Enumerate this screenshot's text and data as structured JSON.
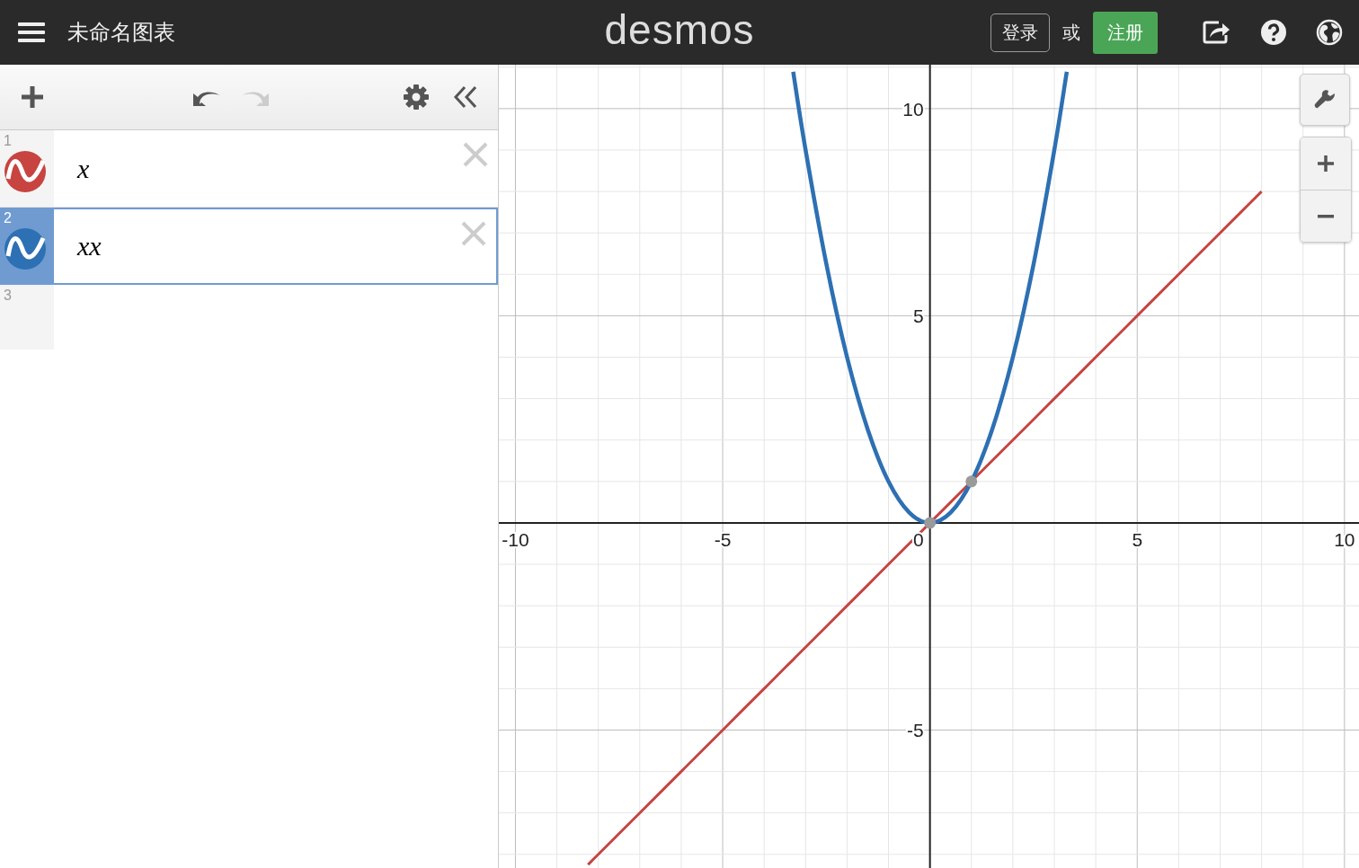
{
  "header": {
    "title": "未命名图表",
    "logo": "desmos",
    "login": "登录",
    "or": "或",
    "signup": "注册"
  },
  "expressions": [
    {
      "number": "1",
      "latex": "x",
      "color": "#c74440",
      "selected": false
    },
    {
      "number": "2",
      "latex": "xx",
      "color": "#2d70b3",
      "selected": true
    },
    {
      "number": "3"
    }
  ],
  "graph": {
    "chart_data": {
      "type": "line",
      "x": [
        -8.25,
        -8,
        -7.5,
        -7,
        -6.5,
        -6,
        -5.5,
        -5,
        -4.5,
        -4,
        -3.5,
        -3.3,
        -3,
        -2.5,
        -2,
        -1.5,
        -1,
        -0.5,
        0,
        0.5,
        1,
        1.5,
        2,
        2.5,
        3,
        3.3,
        3.5,
        4,
        4.5,
        5,
        5.5,
        6,
        6.5,
        7,
        7.5,
        8
      ],
      "series": [
        {
          "color": "#c74440",
          "values": [
            -8.25,
            -8,
            -7.5,
            -7,
            -6.5,
            -6,
            -5.5,
            -5,
            -4.5,
            -4,
            -3.5,
            -3.3,
            -3,
            -2.5,
            -2,
            -1.5,
            -1,
            -0.5,
            0,
            0.5,
            1,
            1.5,
            2,
            2.5,
            3,
            3.3,
            3.5,
            4,
            4.5,
            5,
            5.5,
            6,
            6.5,
            7,
            7.5,
            8
          ]
        },
        {
          "color": "#2d70b3",
          "values": [
            null,
            null,
            null,
            null,
            null,
            null,
            null,
            null,
            null,
            null,
            null,
            10.89,
            9,
            6.25,
            4,
            2.25,
            1,
            0.25,
            0,
            0.25,
            1,
            2.25,
            4,
            6.25,
            9,
            10.89,
            null,
            null,
            null,
            null,
            null,
            null,
            null,
            null,
            null,
            null
          ]
        }
      ],
      "xlim": [
        -10.4,
        10.35
      ],
      "ylim": [
        -8.33,
        11.06
      ],
      "xticks": [
        -10,
        -5,
        0,
        5,
        10
      ],
      "yticks": [
        -5,
        5,
        10
      ],
      "grid": true
    }
  }
}
